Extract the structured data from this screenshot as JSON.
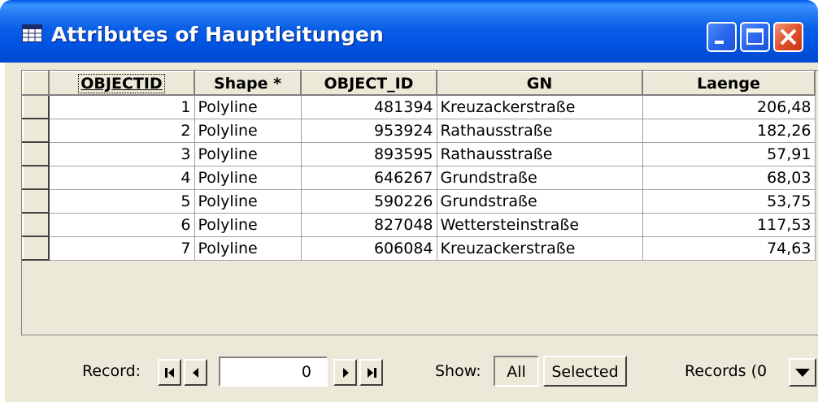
{
  "window": {
    "title": "Attributes of Hauptleitungen",
    "icons": {
      "app": "table-icon",
      "minimize": "minimize-icon",
      "maximize": "maximize-icon",
      "close": "close-icon"
    }
  },
  "table": {
    "columns": [
      "OBJECTID",
      "Shape *",
      "OBJECT_ID",
      "GN",
      "Laenge"
    ],
    "rows": [
      [
        "1",
        "Polyline",
        "481394",
        "Kreuzackerstraße",
        "206,48"
      ],
      [
        "2",
        "Polyline",
        "953924",
        "Rathausstraße",
        "182,26"
      ],
      [
        "3",
        "Polyline",
        "893595",
        "Rathausstraße",
        "57,91"
      ],
      [
        "4",
        "Polyline",
        "646267",
        "Grundstraße",
        "68,03"
      ],
      [
        "5",
        "Polyline",
        "590226",
        "Grundstraße",
        "53,75"
      ],
      [
        "6",
        "Polyline",
        "827048",
        "Wettersteinstraße",
        "117,53"
      ],
      [
        "7",
        "Polyline",
        "606084",
        "Kreuzackerstraße",
        "74,63"
      ]
    ]
  },
  "navigation": {
    "record_label": "Record:",
    "record_value": "0",
    "show_label": "Show:",
    "all_label": "All",
    "selected_label": "Selected",
    "records_label": "Records (0",
    "icons": {
      "first": "first-record-icon",
      "prev": "previous-record-icon",
      "next": "next-record-icon",
      "last": "last-record-icon",
      "options": "dropdown-arrow-icon"
    }
  },
  "colors": {
    "titlebar": "#0054e3",
    "close": "#e0522c",
    "face": "#ece9d8"
  }
}
